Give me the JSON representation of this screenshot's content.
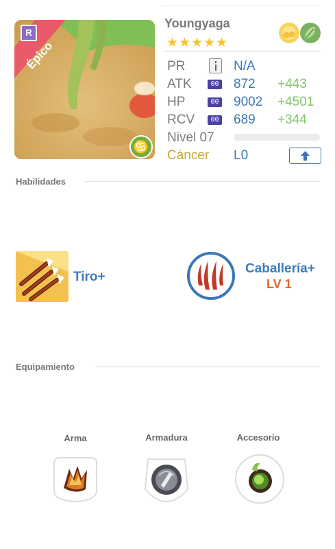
{
  "character": {
    "name": "Youngyaga",
    "rarity": "Épico",
    "card_badge": "R",
    "stars": "★★★★★",
    "element_icons": [
      "sun-cloud-icon",
      "leaf-icon"
    ]
  },
  "stats": {
    "pr": {
      "label": "PR",
      "value": "N/A"
    },
    "atk": {
      "label": "ATK",
      "badge": "00",
      "value": "872",
      "bonus": "+443"
    },
    "hp": {
      "label": "HP",
      "badge": "00",
      "value": "9002",
      "bonus": "+4501"
    },
    "rcv": {
      "label": "RCV",
      "badge": "00",
      "value": "689",
      "bonus": "+344"
    },
    "level": {
      "label": "Nivel 07",
      "xp_fraction": 0
    },
    "sign": {
      "label": "Cáncer",
      "value": "L0"
    }
  },
  "sections": {
    "skills": "Habilidades",
    "equipment": "Equipamiento"
  },
  "skills": [
    {
      "name": "Tiro+"
    },
    {
      "name": "Caballería+",
      "level": "LV 1"
    }
  ],
  "equipment": [
    {
      "label": "Arma"
    },
    {
      "label": "Armadura"
    },
    {
      "label": "Accesorio"
    }
  ],
  "colors": {
    "accent_blue": "#3b78b7",
    "bonus_green": "#7fc46a",
    "star_gold": "#f5c531",
    "sign_gold": "#c7a732",
    "level_orange": "#e0662a",
    "rarity_ribbon": "#e85a6a"
  }
}
